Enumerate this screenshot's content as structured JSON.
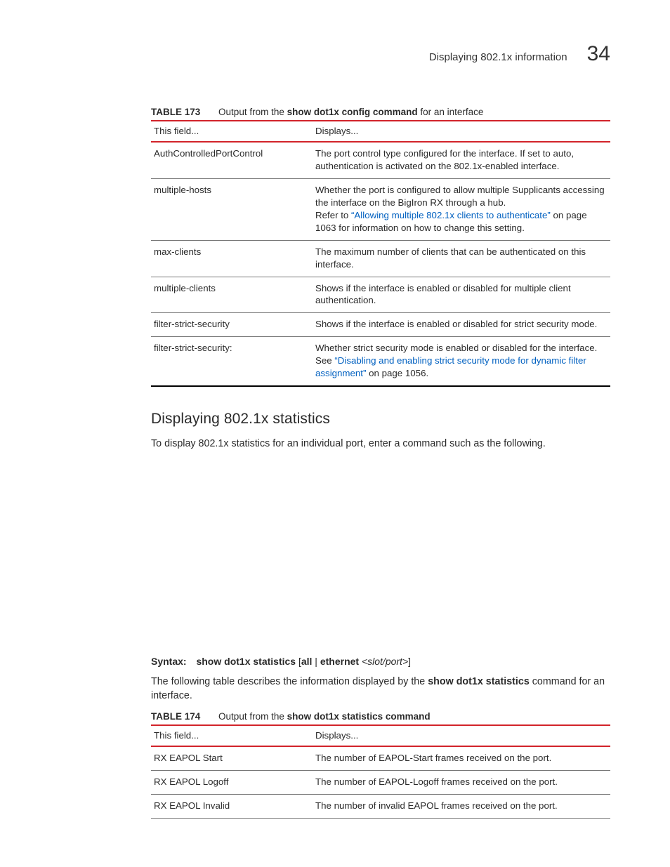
{
  "header": {
    "text": "Displaying 802.1x information",
    "chapter": "34"
  },
  "table173": {
    "label": "TABLE 173",
    "title_pre": "Output from the ",
    "title_bold": "show dot1x config command",
    "title_post": " for an interface",
    "head_field": "This field...",
    "head_disp": "Displays...",
    "rows": [
      {
        "field": "AuthControlledPortControl",
        "disp": "The port control type configured for the interface.  If set to auto, authentication is activated on the 802.1x-enabled interface."
      },
      {
        "field": "multiple-hosts",
        "pre": "Whether the port is configured to allow multiple Supplicants accessing the interface on the BigIron RX through a hub.",
        "ref_pre": "Refer to ",
        "ref_link": "“Allowing multiple 802.1x clients to authenticate”",
        "ref_post": " on page 1063 for information on how to change this setting."
      },
      {
        "field": "max-clients",
        "disp": "The maximum number of clients that can be authenticated on this interface."
      },
      {
        "field": "multiple-clients",
        "disp": "Shows if the interface is enabled or disabled for multiple client authentication."
      },
      {
        "field": "filter-strict-security",
        "disp": "Shows if the interface is enabled or disabled for strict security mode."
      },
      {
        "field": "filter-strict-security:",
        "pre": "Whether strict security mode is enabled or disabled for the interface. See ",
        "ref_link": "“Disabling and enabling strict security mode for dynamic filter assignment”",
        "ref_post": " on page 1056."
      }
    ]
  },
  "section": {
    "title": "Displaying 802.1x statistics",
    "intro": "To display 802.1x statistics for an individual port, enter a command such as the following."
  },
  "syntax": {
    "label": "Syntax:",
    "cmd_bold1": "show dot1x statistics",
    "mid": " [",
    "bold2": "all",
    "mid2": "  | ",
    "bold3": "ethernet",
    "ital": " <slot/port>",
    "tail": "]"
  },
  "para2": {
    "pre": "The following table describes the information displayed by the ",
    "bold": "show dot1x statistics",
    "post": " command for an interface."
  },
  "table174": {
    "label": "TABLE 174",
    "title_pre": "Output from the ",
    "title_bold": "show dot1x statistics command",
    "head_field": "This field...",
    "head_disp": "Displays...",
    "rows": [
      {
        "field": "RX EAPOL Start",
        "disp": "The number of EAPOL-Start frames received on the port."
      },
      {
        "field": "RX EAPOL Logoff",
        "disp": "The number of EAPOL-Logoff frames received on the port."
      },
      {
        "field": "RX EAPOL Invalid",
        "disp": "The number of invalid EAPOL frames received on the port."
      }
    ]
  }
}
